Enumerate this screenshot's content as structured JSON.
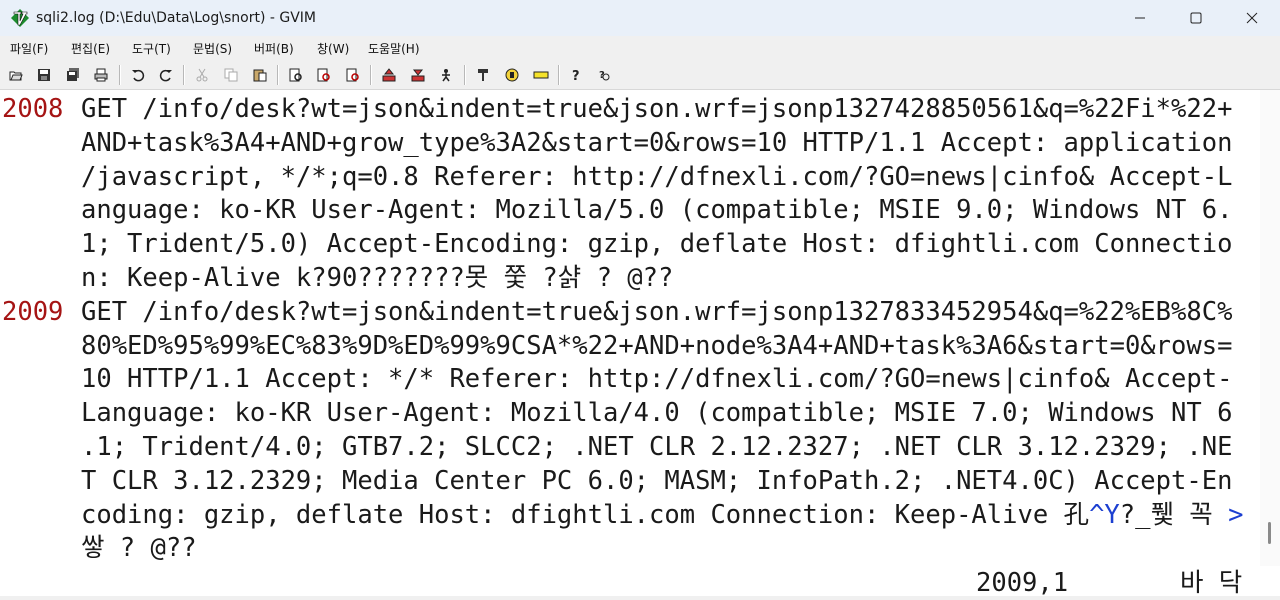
{
  "window": {
    "title": "sqli2.log (D:\\Edu\\Data\\Log\\snort) - GVIM",
    "controls": [
      "minimize-icon",
      "maximize-icon",
      "close-icon"
    ]
  },
  "menu": [
    "파일(F)",
    "편집(E)",
    "도구(T)",
    "문법(S)",
    "버퍼(B)",
    "창(W)",
    "도움말(H)"
  ],
  "toolbar": {
    "icons": [
      "open-icon",
      "save-icon",
      "save-all-icon",
      "print-icon",
      "undo-icon",
      "redo-icon",
      "cut-icon",
      "copy-icon",
      "paste-icon",
      "find-icon",
      "find-next-icon",
      "find-prev-icon",
      "load-session-icon",
      "save-session-icon",
      "run-script-icon",
      "make-icon",
      "shell-icon",
      "tags-icon",
      "help-icon",
      "find-help-icon"
    ]
  },
  "editor": {
    "lines": [
      {
        "number": "2008",
        "text": "GET /info/desk?wt=json&indent=true&json.wrf=jsonp1327428850561&q=%22Fi*%22+"
      },
      {
        "number": "",
        "text": "AND+task%3A4+AND+grow_type%3A2&start=0&rows=10 HTTP/1.1 Accept: application"
      },
      {
        "number": "",
        "text": "/javascript, */*;q=0.8 Referer: http://dfnexli.com/?GO=news|cinfo& Accept-L"
      },
      {
        "number": "",
        "text": "anguage: ko-KR User-Agent: Mozilla/5.0 (compatible; MSIE 9.0; Windows NT 6."
      },
      {
        "number": "",
        "text": "1; Trident/5.0) Accept-Encoding: gzip, deflate Host: dfightli.com Connectio"
      },
      {
        "number": "",
        "text": "n: Keep-Alive k?90???????못 쭟 ?샭 ? @??"
      },
      {
        "number": "2009",
        "text": "GET /info/desk?wt=json&indent=true&json.wrf=jsonp1327833452954&q=%22%EB%8C%"
      },
      {
        "number": "",
        "text": "80%ED%95%99%EC%83%9D%ED%99%9CSA*%22+AND+node%3A4+AND+task%3A6&start=0&rows="
      },
      {
        "number": "",
        "text": "10 HTTP/1.1 Accept: */* Referer: http://dfnexli.com/?GO=news|cinfo& Accept-"
      },
      {
        "number": "",
        "text": "Language: ko-KR User-Agent: Mozilla/4.0 (compatible; MSIE 7.0; Windows NT 6"
      },
      {
        "number": "",
        "text": ".1; Trident/4.0; GTB7.2; SLCC2; .NET CLR 2.12.2327; .NET CLR 3.12.2329; .NE"
      },
      {
        "number": "",
        "text": "T CLR 3.12.2329; Media Center PC 6.0; MASM; InfoPath.2; .NET4.0C) Accept-En"
      },
      {
        "number": "",
        "text": "coding: gzip, deflate Host: dfightli.com Connection: Keep-Alive 孔",
        "special": "^Y",
        "rest": "?_퓇 꼭 ",
        "wrap_marker": ">"
      },
      {
        "number": "",
        "text": "쌓 ? @??"
      }
    ]
  },
  "status": {
    "cursor": "2009,1",
    "position": "바 닥"
  }
}
